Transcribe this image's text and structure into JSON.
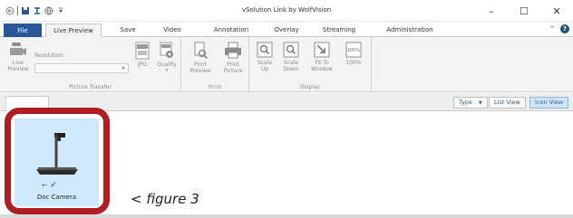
{
  "window": {
    "title": "vSolution Link by WolfVision",
    "minimize": "–",
    "maximize": "☐",
    "close": "✕"
  },
  "tabs": [
    {
      "label": "File"
    },
    {
      "label": "Live Preview"
    },
    {
      "label": "Save"
    },
    {
      "label": "Video"
    },
    {
      "label": "Annotation"
    },
    {
      "label": "Overlay"
    },
    {
      "label": "Streaming"
    },
    {
      "label": "Administration"
    }
  ],
  "help": {
    "collapse": "^",
    "help": "?"
  },
  "ribbon": {
    "picture_transfer": {
      "label": "Picture Transfer",
      "live_preview": "Live Preview",
      "resolution_label": "Resolution:",
      "resolution_value": "",
      "jpg": "JPG",
      "quality": "Quality"
    },
    "print": {
      "label": "Print",
      "print_preview": "Print Preview",
      "print_picture": "Print Picture"
    },
    "display": {
      "label": "Display",
      "scale_up": "Scale Up",
      "scale_down": "Scale Down",
      "fit_to_window": "Fit To Window",
      "hundred": "100%"
    }
  },
  "view_bar": {
    "type": "Type",
    "list_view": "List View",
    "icon_view": "Icon View"
  },
  "devices": [
    {
      "label": "Doc Camera",
      "status": "✓"
    }
  ],
  "caption": "< figure 3",
  "colors": {
    "file_tab": "#2b579a",
    "highlight_frame": "#b01e24",
    "device_tile": "#cfe8fb",
    "icon_view_active": "#cfe5f7"
  }
}
